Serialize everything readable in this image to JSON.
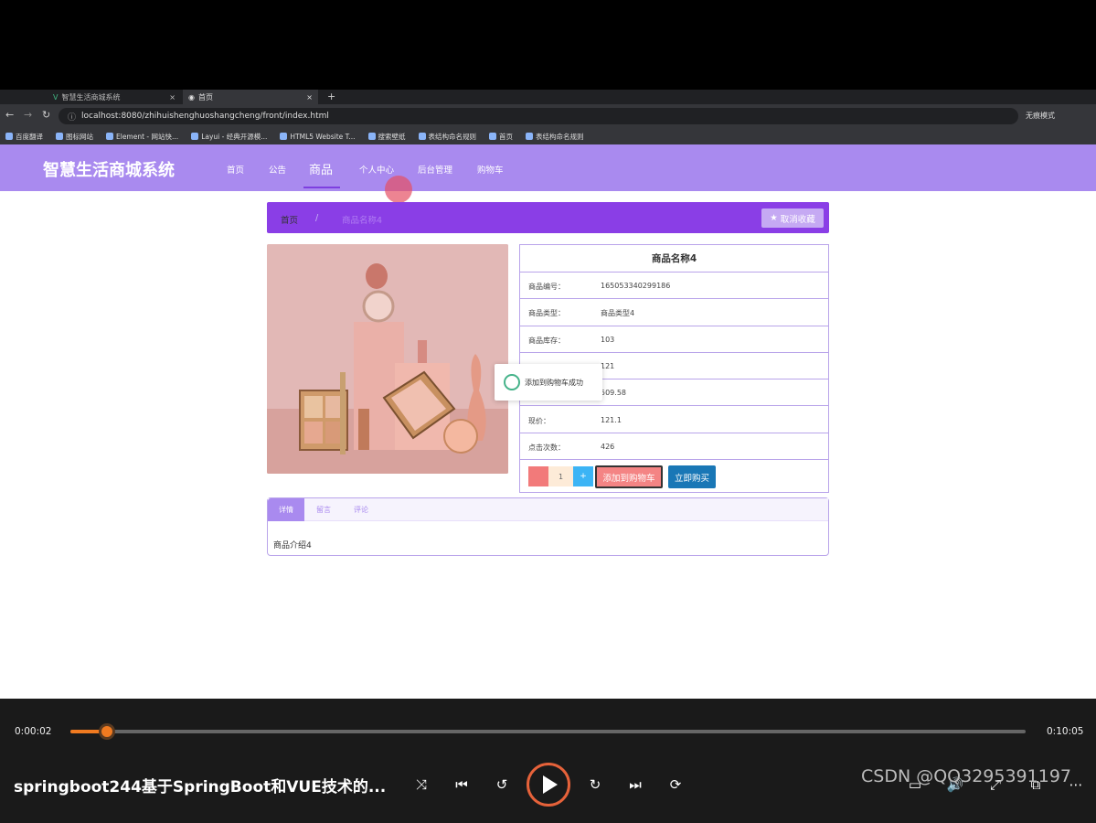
{
  "browser": {
    "tabs": [
      {
        "label": "智慧生活商城系统"
      },
      {
        "label": "首页"
      }
    ],
    "url": "localhost:8080/zhihuishenghuoshangcheng/front/index.html",
    "profile": "无痕模式",
    "bookmarks": [
      "百度翻译",
      "图标网站",
      "Element - 网站快...",
      "Layui - 经典开源模...",
      "HTML5 Website T...",
      "搜索壁纸",
      "表结构命名规则",
      "首页",
      "表结构命名规则"
    ]
  },
  "site": {
    "brand": "智慧生活商城系统",
    "nav": [
      "首页",
      "公告",
      "商品",
      "个人中心",
      "后台管理",
      "购物车"
    ]
  },
  "breadcrumb": {
    "home": "首页",
    "separator": "/",
    "current": "商品名称4",
    "fav_button": "取消收藏"
  },
  "product": {
    "title": "商品名称4",
    "rows": [
      {
        "k": "商品编号：",
        "v": "165053340299186"
      },
      {
        "k": "商品类型：",
        "v": "商品类型4"
      },
      {
        "k": "商品库存：",
        "v": "103"
      },
      {
        "k": "",
        "v": "121"
      },
      {
        "k": "",
        "v": "509.58"
      },
      {
        "k": "现价：",
        "v": "121.1"
      },
      {
        "k": "点击次数：",
        "v": "426"
      }
    ],
    "qty": "1",
    "plus": "+",
    "add_cart": "添加到购物车",
    "buy_now": "立即购买"
  },
  "toast": "添加到购物车成功",
  "tabs": {
    "items": [
      "详情",
      "留言",
      "评论"
    ],
    "content": "商品介绍4"
  },
  "player": {
    "elapsed": "0:00:02",
    "duration": "0:10:05",
    "progress": 0.0033,
    "title": "springboot244基于SpringBoot和VUE技术的...",
    "watermark": "CSDN @QQ3295391197",
    "accent": "#f07a20"
  }
}
